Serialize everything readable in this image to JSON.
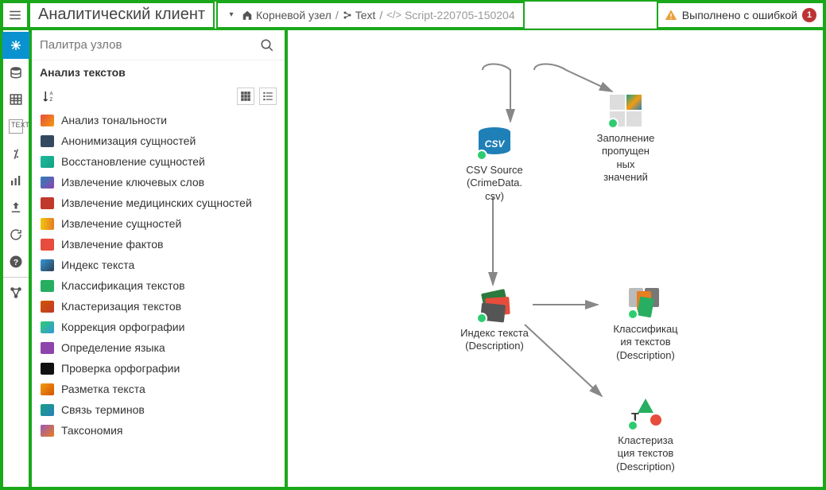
{
  "header": {
    "title": "Аналитический клиент",
    "breadcrumb": {
      "root": "Корневой узел",
      "folder": "Text",
      "script": "Script-220705-150204"
    },
    "status": {
      "text": "Выполнено с ошибкой",
      "count": "1"
    }
  },
  "search": {
    "placeholder": "Палитра узлов"
  },
  "category": {
    "title": "Анализ текстов"
  },
  "palette": [
    "Анализ тональности",
    "Анонимизация сущностей",
    "Восстановление сущностей",
    "Извлечение ключевых слов",
    "Извлечение медицинских сущностей",
    "Извлечение сущностей",
    "Извлечение фактов",
    "Индекс текста",
    "Классификация текстов",
    "Кластеризация текстов",
    "Коррекция орфографии",
    "Определение языка",
    "Проверка орфографии",
    "Разметка текста",
    "Связь терминов",
    "Таксономия"
  ],
  "canvas": {
    "n1": {
      "line1": "CSV Source",
      "line2": "(CrimeData.",
      "line3": "csv)"
    },
    "n2": {
      "line1": "Заполнение",
      "line2": "пропущен",
      "line3": "ных",
      "line4": "значений"
    },
    "n3": {
      "line1": "Индекс текста",
      "line2": "(Description)"
    },
    "n4": {
      "line1": "Классификац",
      "line2": "ия текстов",
      "line3": "(Description)"
    },
    "n5": {
      "line1": "Кластериза",
      "line2": "ция текстов",
      "line3": "(Description)"
    }
  }
}
